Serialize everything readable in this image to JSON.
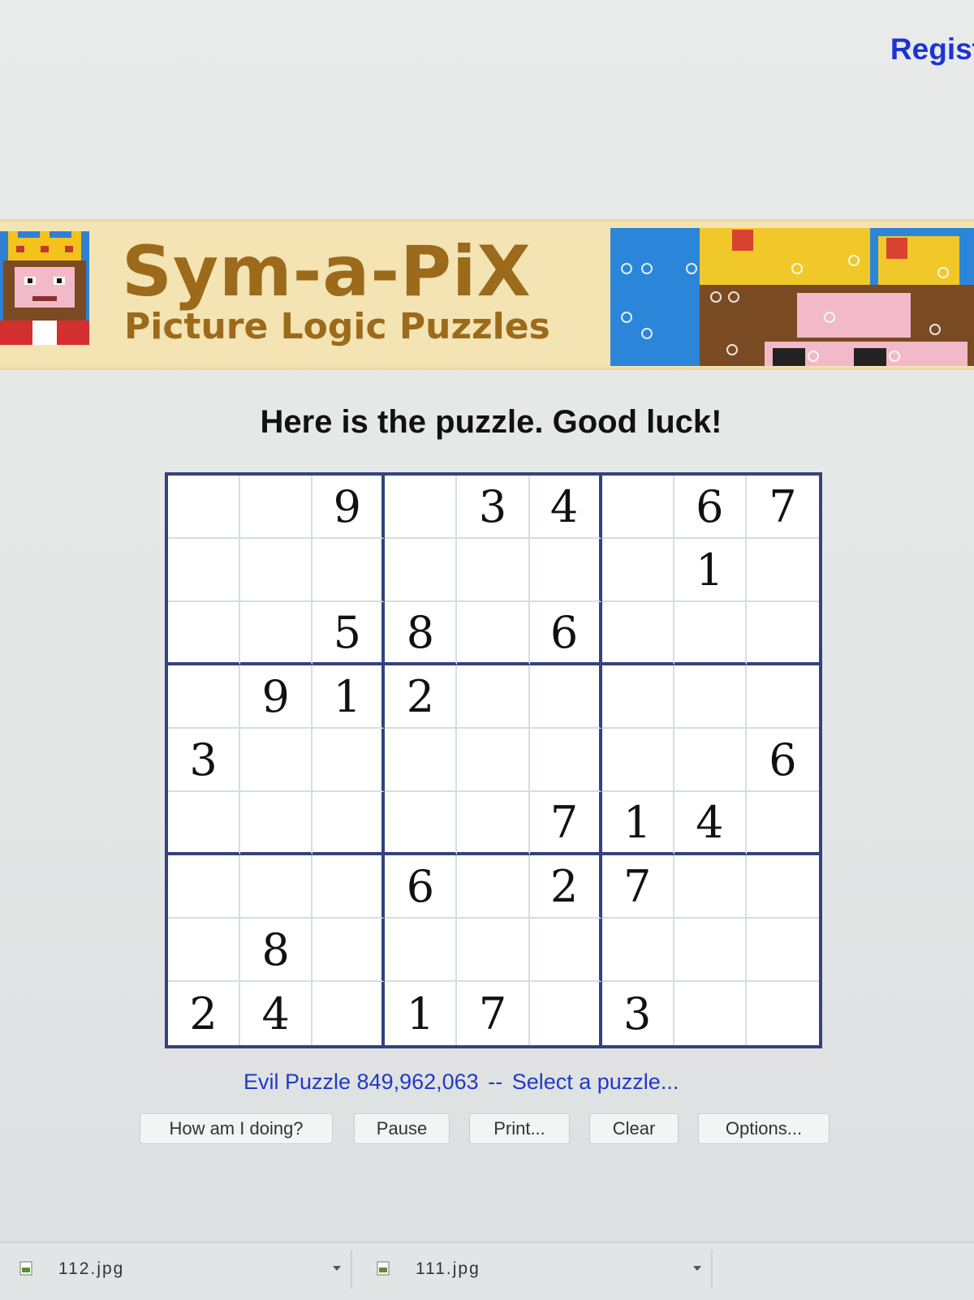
{
  "header": {
    "register_link": "Regist"
  },
  "banner": {
    "title": "Sym-a-PiX",
    "subtitle": "Picture Logic Puzzles"
  },
  "main": {
    "heading": "Here is the puzzle. Good luck!",
    "grid": [
      [
        "",
        "",
        "9",
        "",
        "3",
        "4",
        "",
        "6",
        "7"
      ],
      [
        "",
        "",
        "",
        "",
        "",
        "",
        "",
        "1",
        ""
      ],
      [
        "",
        "",
        "5",
        "8",
        "",
        "6",
        "",
        "",
        ""
      ],
      [
        "",
        "9",
        "1",
        "2",
        "",
        "",
        "",
        "",
        ""
      ],
      [
        "3",
        "",
        "",
        "",
        "",
        "",
        "",
        "",
        "6"
      ],
      [
        "",
        "",
        "",
        "",
        "",
        "7",
        "1",
        "4",
        ""
      ],
      [
        "",
        "",
        "",
        "6",
        "",
        "2",
        "7",
        "",
        ""
      ],
      [
        "",
        "8",
        "",
        "",
        "",
        "",
        "",
        "",
        ""
      ],
      [
        "2",
        "4",
        "",
        "1",
        "7",
        "",
        "3",
        "",
        ""
      ]
    ],
    "puzzle_label": "Evil Puzzle 849,962,063",
    "separator": "--",
    "select_link": "Select a puzzle..."
  },
  "buttons": {
    "how_am_i_doing": "How am I doing?",
    "pause": "Pause",
    "print": "Print...",
    "clear": "Clear",
    "options": "Options..."
  },
  "downloads": [
    {
      "name": "112.jpg"
    },
    {
      "name": "111.jpg"
    }
  ],
  "colors": {
    "link_blue": "#2239c7",
    "grid_border": "#34427e",
    "logo_brown": "#9b6a1b",
    "banner_bg": "#f4e3b3"
  }
}
